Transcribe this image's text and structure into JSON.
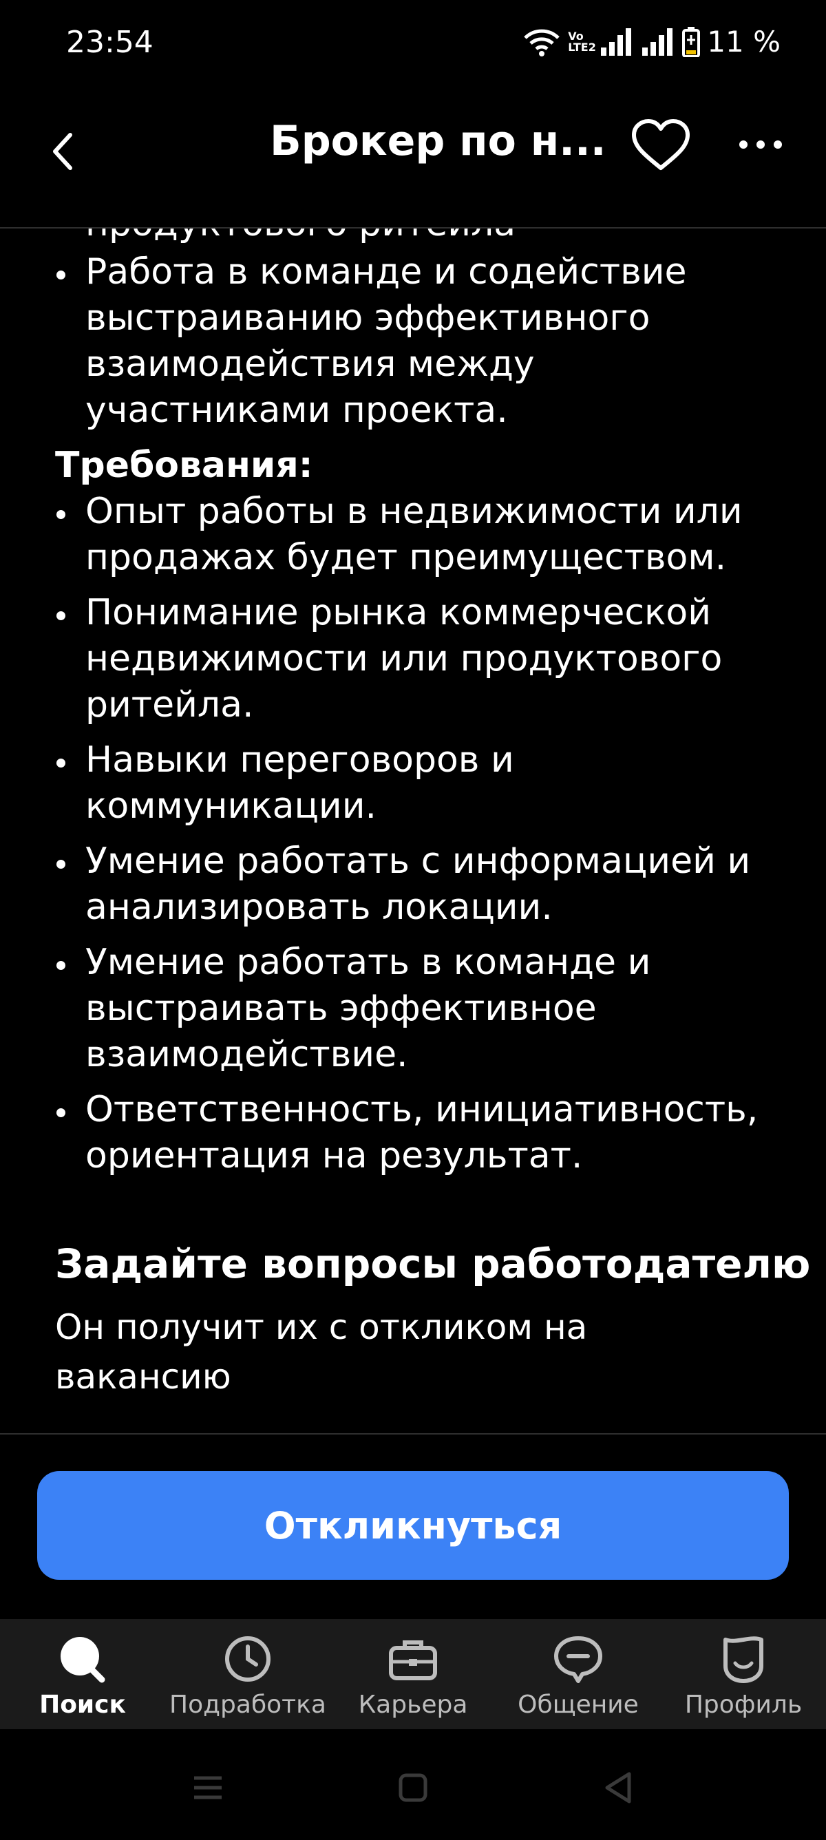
{
  "status_bar": {
    "time": "23:54",
    "network_label": "Vo LTE2",
    "battery": "11 %"
  },
  "header": {
    "title": "Брокер по н..."
  },
  "content": {
    "cropped_line": "продуктового ритейла",
    "bullets_top": [
      "Работа в команде и содействие выстраиванию эффективного взаимодействия между участниками проекта."
    ],
    "requirements_label": "Требования:",
    "requirements": [
      "Опыт работы в недвижимости или продажах будет преимуществом.",
      "Понимание рынка коммерческой недвижимости или продуктового ритейла.",
      "Навыки переговоров и коммуникации.",
      "Умение работать с информацией и анализировать локации.",
      "Умение работать в команде и выстраивать эффективное взаимодействие.",
      "Ответственность, инициативность, ориентация на результат."
    ],
    "ask_title": "Задайте вопросы работодателю",
    "ask_subtitle": "Он получит их с откликом на вакансию"
  },
  "apply_button": {
    "label": "Откликнуться",
    "color": "#3c82f6"
  },
  "bottom_nav": {
    "items": [
      {
        "label": "Поиск",
        "icon": "search-icon",
        "active": true
      },
      {
        "label": "Подработка",
        "icon": "clock-icon",
        "active": false
      },
      {
        "label": "Карьера",
        "icon": "briefcase-icon",
        "active": false
      },
      {
        "label": "Общение",
        "icon": "chat-icon",
        "active": false
      },
      {
        "label": "Профиль",
        "icon": "profile-icon",
        "active": false
      }
    ]
  }
}
